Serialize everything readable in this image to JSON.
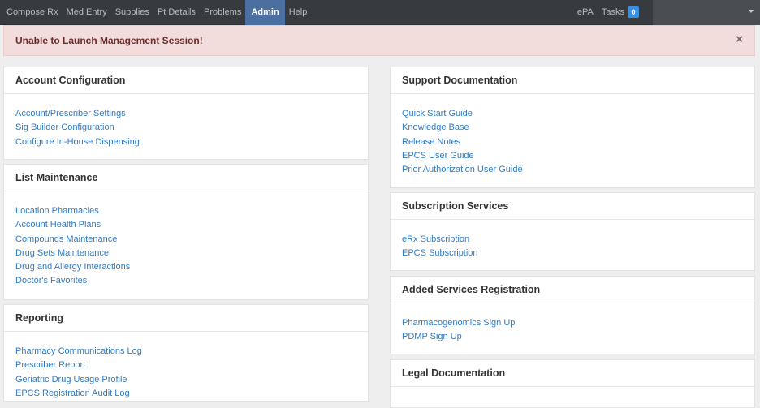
{
  "nav": {
    "items": [
      {
        "label": "Compose Rx",
        "active": false
      },
      {
        "label": "Med Entry",
        "active": false
      },
      {
        "label": "Supplies",
        "active": false
      },
      {
        "label": "Pt Details",
        "active": false
      },
      {
        "label": "Problems",
        "active": false
      },
      {
        "label": "Admin",
        "active": true
      },
      {
        "label": "Help",
        "active": false
      }
    ],
    "right": {
      "epa": "ePA",
      "tasks": "Tasks",
      "tasks_count": "0"
    },
    "colors": {
      "bar": "#373a3e",
      "active": "#4a6fa0",
      "badge": "#3a8fe0"
    }
  },
  "alert": {
    "message": "Unable to Launch Management Session!",
    "close": "×"
  },
  "panels": {
    "account": {
      "title": "Account Configuration",
      "links": [
        "Account/Prescriber Settings",
        "Sig Builder Configuration",
        "Configure In-House Dispensing"
      ]
    },
    "list": {
      "title": "List Maintenance",
      "links": [
        "Location Pharmacies",
        "Account Health Plans",
        "Compounds Maintenance",
        "Drug Sets Maintenance",
        "Drug and Allergy Interactions",
        "Doctor's Favorites"
      ]
    },
    "reporting": {
      "title": "Reporting",
      "links": [
        "Pharmacy Communications Log",
        "Prescriber Report",
        "Geriatric Drug Usage Profile",
        "EPCS Registration Audit Log"
      ]
    },
    "support": {
      "title": "Support Documentation",
      "links": [
        "Quick Start Guide",
        "Knowledge Base",
        "Release Notes",
        "EPCS User Guide",
        "Prior Authorization User Guide"
      ]
    },
    "subscription": {
      "title": "Subscription Services",
      "links": [
        "eRx Subscription",
        "EPCS Subscription"
      ]
    },
    "added": {
      "title": "Added Services Registration",
      "links": [
        "Pharmacogenomics Sign Up",
        "PDMP Sign Up"
      ]
    },
    "legal": {
      "title": "Legal Documentation",
      "links": []
    }
  }
}
